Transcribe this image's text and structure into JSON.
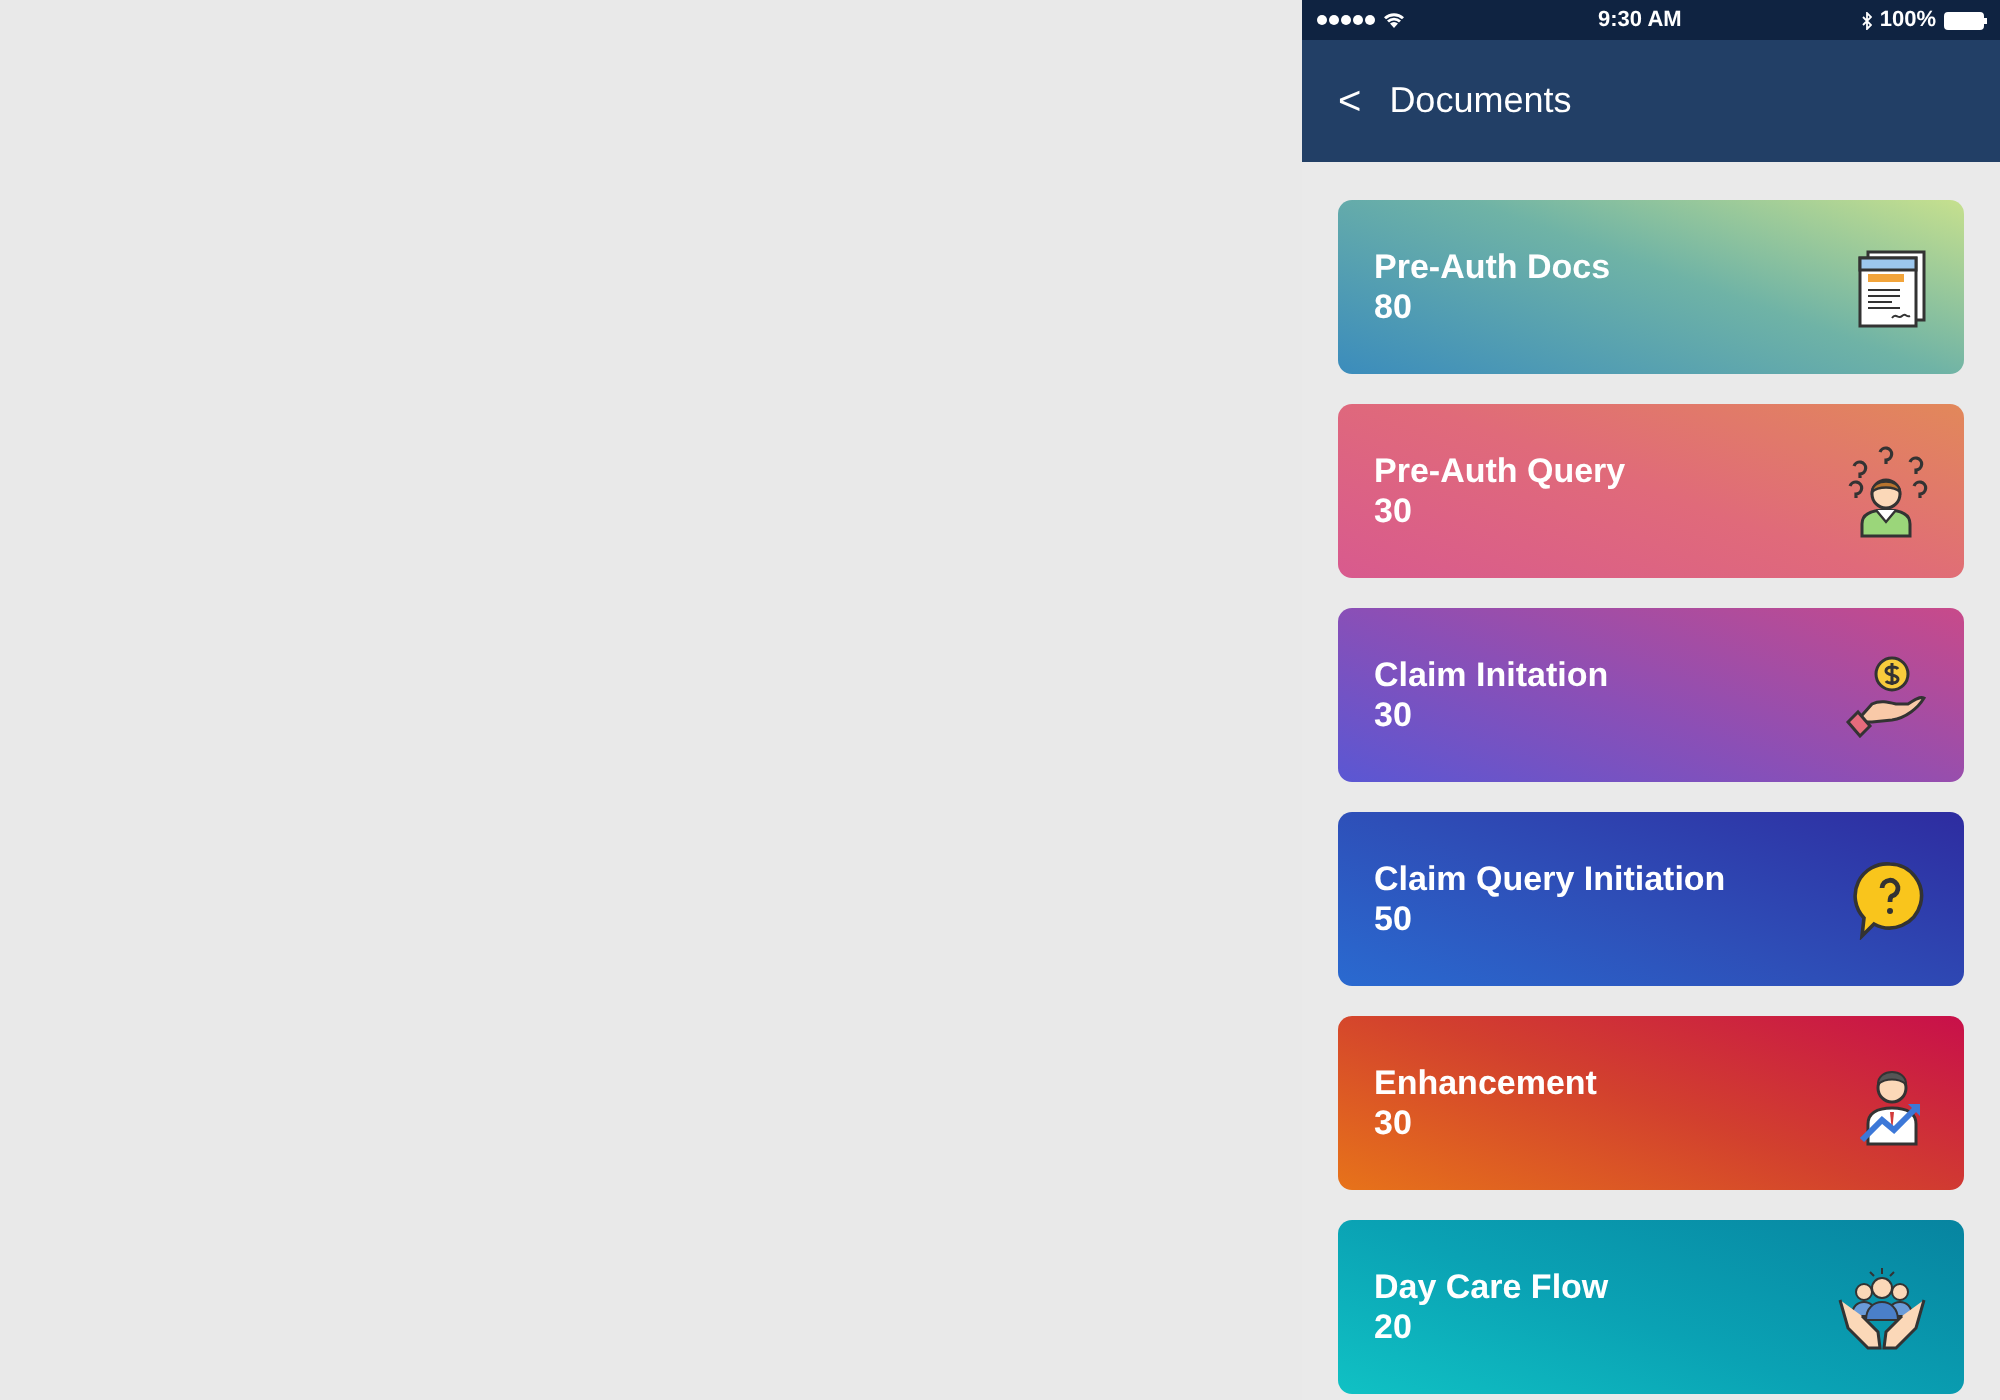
{
  "status_bar": {
    "time": "9:30 AM",
    "battery": "100%"
  },
  "header": {
    "back": "<",
    "title": "Documents"
  },
  "cards": [
    {
      "kind": "docs",
      "title": "Pre-Auth Docs",
      "count": "80"
    },
    {
      "kind": "query",
      "title": "Pre-Auth Query",
      "count": "30"
    },
    {
      "kind": "claim",
      "title": "Claim Initation",
      "count": "30"
    },
    {
      "kind": "claim-query",
      "title": "Claim Query Initiation",
      "count": "50"
    },
    {
      "kind": "enhancement",
      "title": "Enhancement",
      "count": "30"
    },
    {
      "kind": "daycare",
      "title": "Day Care Flow",
      "count": "20"
    }
  ]
}
